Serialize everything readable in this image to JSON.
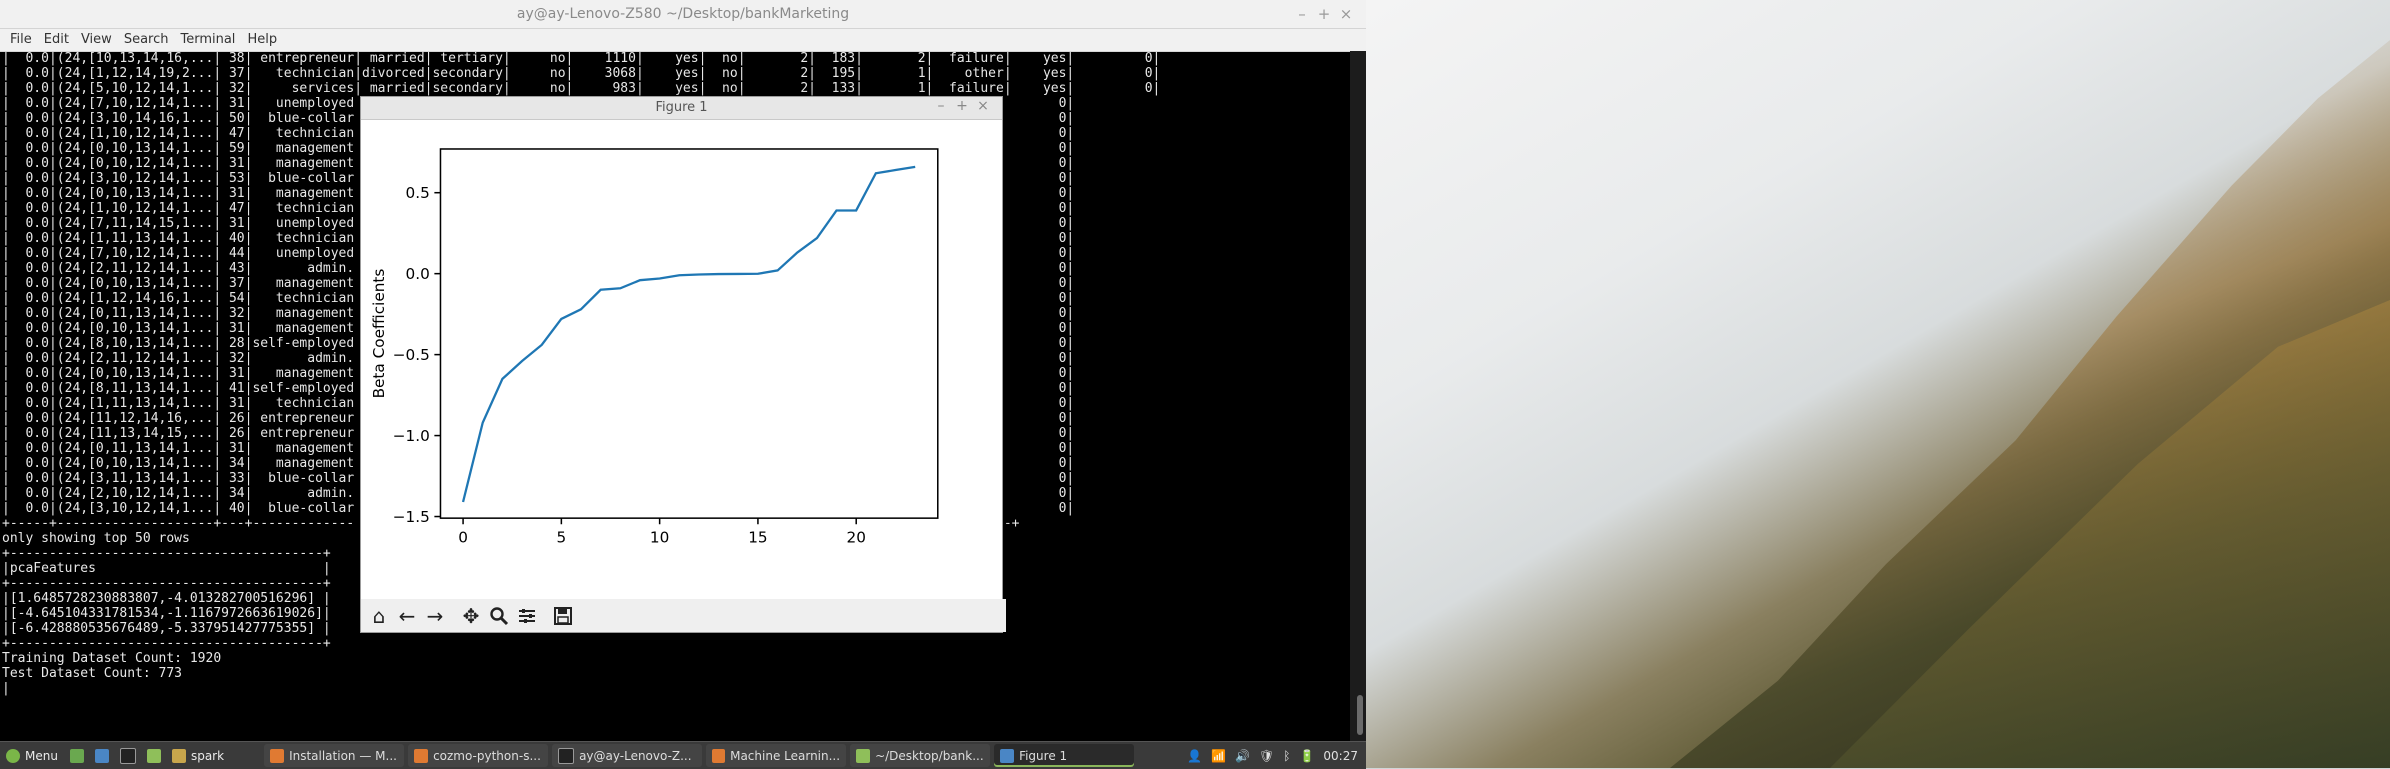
{
  "terminal": {
    "title": "ay@ay-Lenovo-Z580 ~/Desktop/bankMarketing",
    "menu": [
      "File",
      "Edit",
      "View",
      "Search",
      "Terminal",
      "Help"
    ],
    "lines": [
      "|  0.0|(24,[10,13,14,16,...| 38| entrepreneur| married| tertiary|     no|    1110|    yes|  no|       2|  183|       2|  failure|    yes|         0|",
      "|  0.0|(24,[1,12,14,19,2...| 37|   technician|divorced|secondary|     no|    3068|    yes|  no|       2|  195|       1|    other|    yes|         0|",
      "|  0.0|(24,[5,10,12,14,1...| 32|     services| married|secondary|     no|     983|    yes|  no|       2|  133|       1|  failure|    yes|         0|",
      "|  0.0|(24,[7,10,12,14,1...| 31|   unemployed                                                                        |    yes|         0|",
      "|  0.0|(24,[3,10,14,16,1...| 50|  blue-collar                                                                       e|    yes|         0|",
      "|  0.0|(24,[1,10,12,14,1...| 47|   technician                                                                       e|    yes|         0|",
      "|  0.0|(24,[0,10,13,14,1...| 59|   management                                                                       e|    yes|         0|",
      "|  0.0|(24,[0,10,12,14,1...| 31|   management                                                                       e|    yes|         0|",
      "|  0.0|(24,[3,10,12,14,1...| 53|  blue-collar                                                                       e|    yes|         0|",
      "|  0.0|(24,[0,10,13,14,1...| 31|   management                                                                       r|    yes|         0|",
      "|  0.0|(24,[1,10,12,14,1...| 47|   technician                                                                       r|    yes|         0|",
      "|  0.0|(24,[7,11,14,15,1...| 31|   unemployed                                                                       r|    yes|         0|",
      "|  0.0|(24,[1,11,13,14,1...| 40|   technician                                                                       r|    yes|         0|",
      "|  0.0|(24,[7,10,12,14,1...| 44|   unemployed                                                                       r|    yes|         0|",
      "|  0.0|(24,[2,11,12,14,1...| 43|       admin.                                                                       r|    yes|         0|",
      "|  0.0|(24,[0,10,13,14,1...| 37|   management                                                                       r|    yes|         0|",
      "|  0.0|(24,[1,12,14,16,1...| 54|   technician                                                                       r|    yes|         0|",
      "|  0.0|(24,[0,11,13,14,1...| 32|   management                                                                       r|    yes|         0|",
      "|  0.0|(24,[0,10,13,14,1...| 31|   management                                                                       s|    yes|         0|",
      "|  0.0|(24,[8,10,13,14,1...| 28|self-employed                                                                       e|    yes|         0|",
      "|  0.0|(24,[2,11,12,14,1...| 32|       admin.                                                                       e|    yes|         0|",
      "|  0.0|(24,[0,10,13,14,1...| 31|   management                                                                       e|    yes|         0|",
      "|  0.0|(24,[8,11,13,14,1...| 41|self-employed                                                                       e|    yes|         0|",
      "|  0.0|(24,[1,11,13,14,1...| 31|   technician                                                                       e|    yes|         0|",
      "|  0.0|(24,[11,12,14,16,...| 26| entrepreneur                                                                       e|    yes|         0|",
      "|  0.0|(24,[11,13,14,15,...| 26| entrepreneur                                                                       e|    yes|         0|",
      "|  0.0|(24,[0,11,13,14,1...| 31|   management                                                                       s|    yes|         0|",
      "|  0.0|(24,[0,10,13,14,1...| 34|   management                                                                       s|    yes|         0|",
      "|  0.0|(24,[3,11,13,14,1...| 33|  blue-collar                                                                       s|    yes|         0|",
      "|  0.0|(24,[2,10,12,14,1...| 34|       admin.                                                                       s|    yes|         0|",
      "|  0.0|(24,[3,10,12,14,1...| 40|  blue-collar                                                                       s|    yes|         0|",
      "+-----+--------------------+---+-------------                                                                 +-------+----------+",
      "only showing top 50 rows",
      "",
      "+----------------------------------------+",
      "|pcaFeatures                             |",
      "+----------------------------------------+",
      "|[1.6485728230883807,-4.013282700516296] |",
      "|[-4.645104331781534,-1.1167972663619026]|",
      "|[-6.428880535676489,-5.337951427775355] |",
      "+----------------------------------------+",
      "",
      "Training Dataset Count: 1920",
      "Test Dataset Count: 773",
      "|"
    ]
  },
  "figure": {
    "title": "Figure 1",
    "toolbar_icons": [
      "home-icon",
      "back-arrow-icon",
      "forward-arrow-icon",
      "pan-icon",
      "zoom-icon",
      "configure-subplots-icon",
      "save-icon"
    ]
  },
  "chart_data": {
    "type": "line",
    "title": "",
    "xlabel": "",
    "ylabel": "Beta Coefficients",
    "x": [
      0,
      1,
      2,
      3,
      4,
      5,
      6,
      7,
      8,
      9,
      10,
      11,
      12,
      13,
      14,
      15,
      16,
      17,
      18,
      19,
      20,
      21,
      22,
      23
    ],
    "series": [
      {
        "values": [
          -1.41,
          -0.92,
          -0.65,
          -0.54,
          -0.44,
          -0.28,
          -0.22,
          -0.1,
          -0.09,
          -0.04,
          -0.03,
          -0.01,
          -0.005,
          -0.003,
          -0.002,
          -0.001,
          0.02,
          0.13,
          0.22,
          0.39,
          0.39,
          0.62,
          0.64,
          0.66
        ],
        "color": "#1f77b4"
      }
    ],
    "xlim": [
      -1.15,
      24.15
    ],
    "ylim": [
      -1.51,
      0.77
    ],
    "xticks": [
      "0",
      "5",
      "10",
      "15",
      "20"
    ],
    "yticks": [
      "0.5",
      "0.0",
      "−0.5",
      "−1.0",
      "−1.5"
    ],
    "grid": false
  },
  "taskbar": {
    "menu_label": "Menu",
    "folder_label": "spark",
    "apps": [
      {
        "label": "Installation — M...",
        "active": false
      },
      {
        "label": "cozmo-python-s...",
        "active": false
      },
      {
        "label": "ay@ay-Lenovo-Z...",
        "active": false
      },
      {
        "label": "Machine Learnin...",
        "active": false
      },
      {
        "label": "~/Desktop/bank...",
        "active": false
      },
      {
        "label": "Figure 1",
        "active": true
      }
    ],
    "clock": "00:27"
  }
}
